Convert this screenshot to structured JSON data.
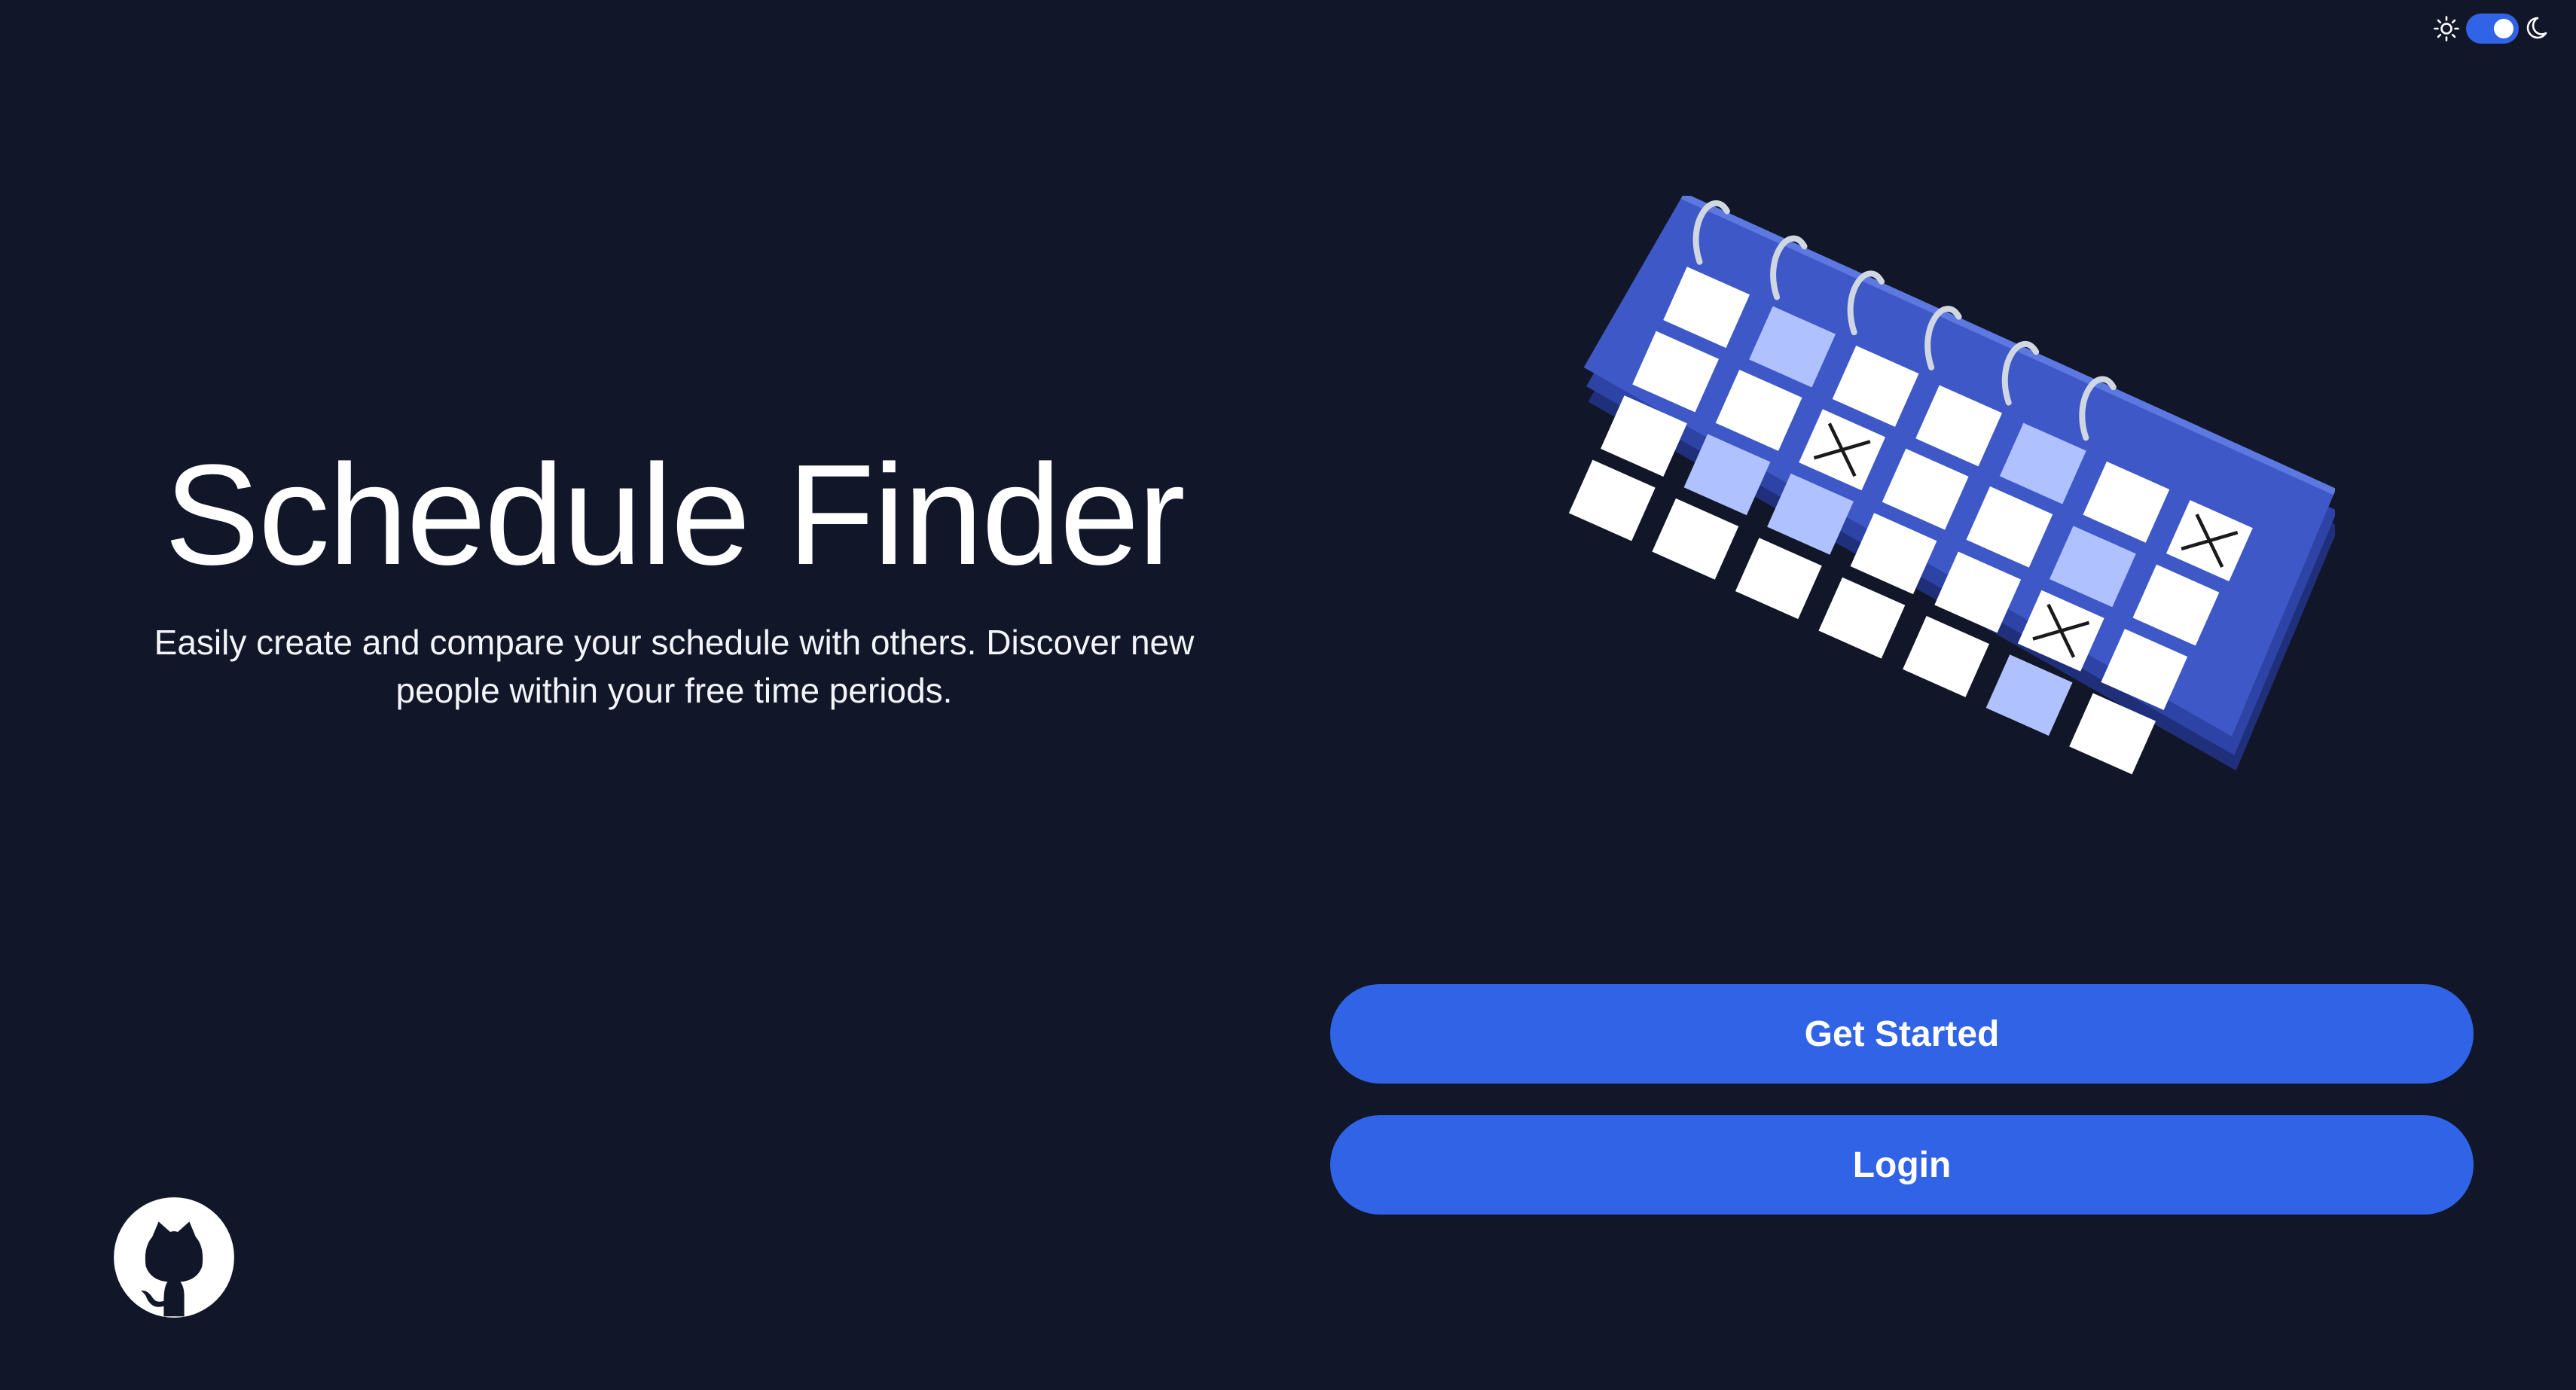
{
  "app": {
    "title": "Schedule Finder",
    "subtitle": "Easily create and compare your schedule with others. Discover new people within your free time periods."
  },
  "theme": {
    "mode": "dark",
    "toggle_on": true,
    "icons": [
      "sun-icon",
      "moon-icon"
    ]
  },
  "actions": {
    "get_started": "Get Started",
    "login": "Login"
  },
  "footer": {
    "icon": "github-icon"
  },
  "colors": {
    "background": "#111729",
    "accent": "#3163E6",
    "calendar": "#3E58C7",
    "highlight": "#AFC1FF"
  }
}
